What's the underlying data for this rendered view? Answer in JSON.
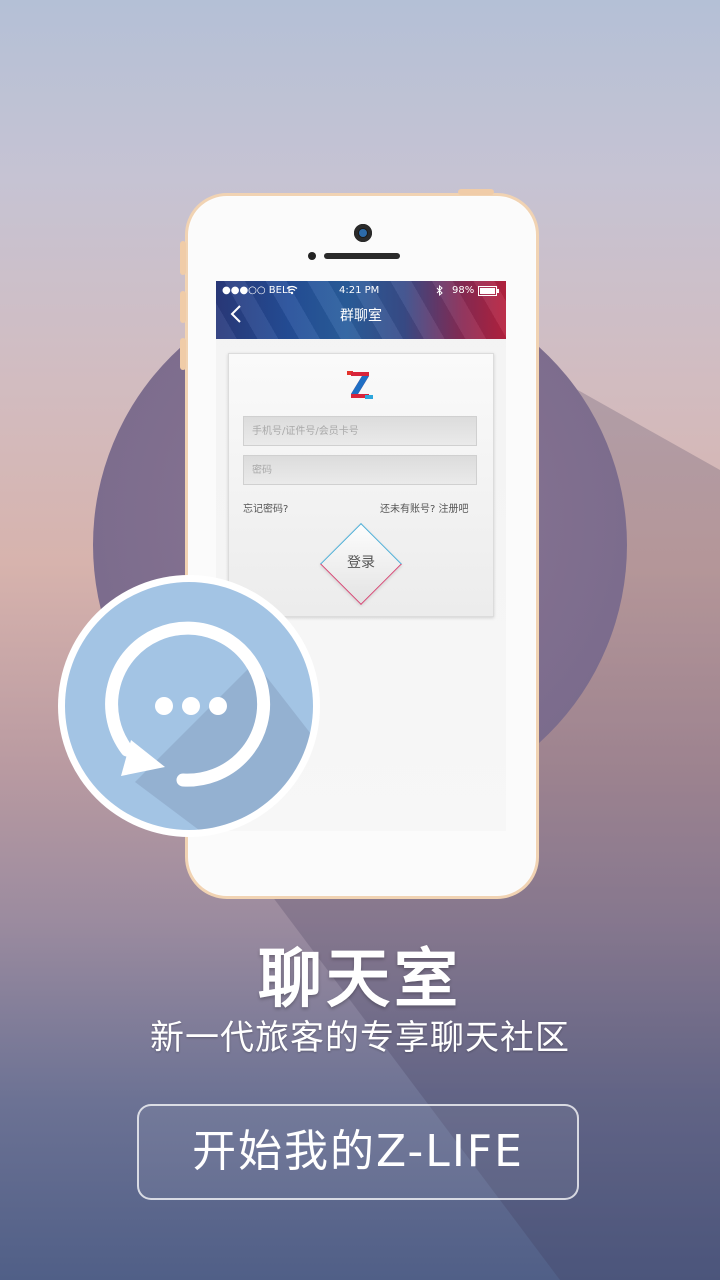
{
  "phone": {
    "status_bar": {
      "carrier": "●●●○○ BELL",
      "time": "4:21 PM",
      "battery": "98%"
    },
    "nav": {
      "back_icon": "chevron-left-icon",
      "title": "群聊室"
    },
    "login_form": {
      "logo_letter": "Z",
      "account_placeholder": "手机号/证件号/会员卡号",
      "password_placeholder": "密码",
      "forgot_password": "忘记密码?",
      "register_link": "还未有账号? 注册吧",
      "login_button": "登录"
    }
  },
  "badge_icon": "chat-bubble-icon",
  "headline": "聊天室",
  "subheadline": "新一代旅客的专享聊天社区",
  "cta_button": "开始我的Z-LIFE",
  "colors": {
    "badge_blue": "#a3c4e4",
    "phone_frame": "#f1d3b3",
    "nav_blue": "#254f9a",
    "nav_red": "#b8223f"
  }
}
